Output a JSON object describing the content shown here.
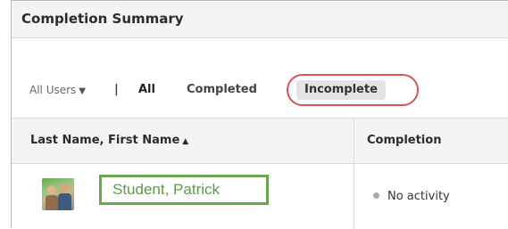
{
  "panel": {
    "title": "Completion Summary"
  },
  "filters": {
    "users_dropdown": "All Users",
    "separator": "|",
    "all": "All",
    "completed": "Completed",
    "incomplete": "Incomplete",
    "selected": "Incomplete"
  },
  "table": {
    "columns": [
      "Last Name, First Name",
      "Completion"
    ],
    "sort_indicator": "▲",
    "rows": [
      {
        "name": "Student, Patrick",
        "completion": "No activity"
      }
    ]
  },
  "colors": {
    "highlight_oval": "#d9534f",
    "highlight_box": "#6aa84f",
    "student_link": "#5a9e3f"
  },
  "icons": [
    "caret-down-icon",
    "sort-ascending-icon",
    "status-dot-icon",
    "user-avatar"
  ]
}
